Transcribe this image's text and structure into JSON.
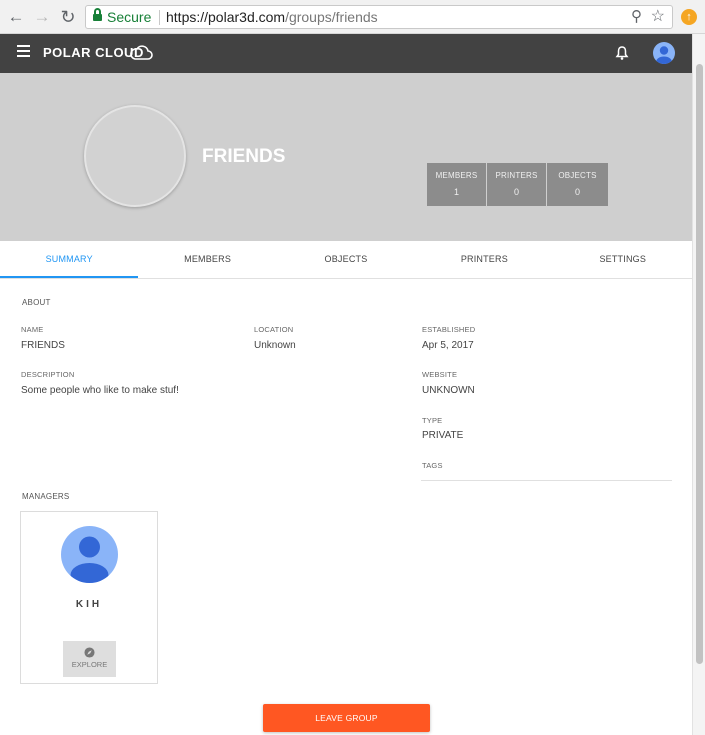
{
  "browser": {
    "secure_label": "Secure",
    "url_host": "https://polar3d.com",
    "url_path": "/groups/friends"
  },
  "app": {
    "brand": "POLAR CLOUD"
  },
  "group": {
    "title": "FRIENDS",
    "stats": [
      {
        "label": "MEMBERS",
        "value": "1"
      },
      {
        "label": "PRINTERS",
        "value": "0"
      },
      {
        "label": "OBJECTS",
        "value": "0"
      }
    ]
  },
  "tabs": [
    {
      "label": "SUMMARY",
      "active": true
    },
    {
      "label": "MEMBERS",
      "active": false
    },
    {
      "label": "OBJECTS",
      "active": false
    },
    {
      "label": "PRINTERS",
      "active": false
    },
    {
      "label": "SETTINGS",
      "active": false
    }
  ],
  "about": {
    "section_label": "ABOUT",
    "name_label": "NAME",
    "name_value": "FRIENDS",
    "location_label": "LOCATION",
    "location_value": "Unknown",
    "established_label": "ESTABLISHED",
    "established_value": "Apr 5, 2017",
    "description_label": "DESCRIPTION",
    "description_value": "Some people who like to make stuf!",
    "website_label": "WEBSITE",
    "website_value": "UNKNOWN",
    "type_label": "TYPE",
    "type_value": "PRIVATE",
    "tags_label": "TAGS"
  },
  "managers": {
    "section_label": "MANAGERS",
    "items": [
      {
        "name": "KIH",
        "explore_label": "EXPLORE"
      }
    ]
  },
  "actions": {
    "leave_label": "LEAVE GROUP"
  },
  "colors": {
    "accent": "#2196f3",
    "leave_button": "#ff5722",
    "header": "#424242",
    "hero": "#cfcfcf"
  }
}
